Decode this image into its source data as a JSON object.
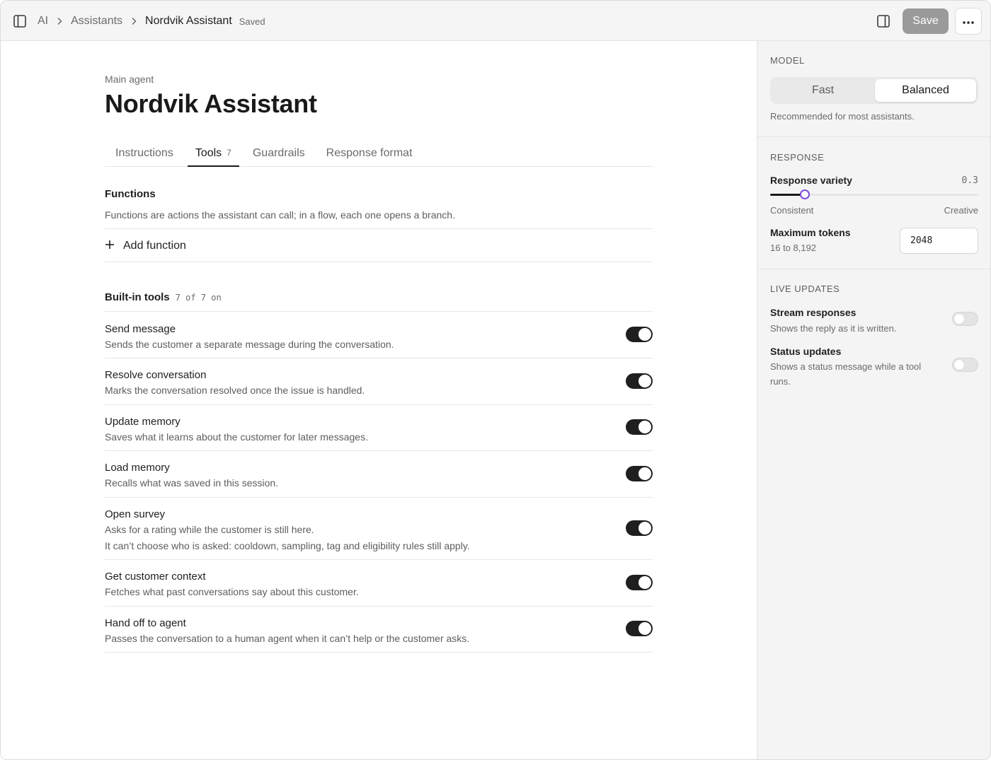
{
  "topbar": {
    "breadcrumbs": [
      "AI",
      "Assistants",
      "Nordvik Assistant"
    ],
    "saved_status": "Saved",
    "save_label": "Save",
    "icons": {
      "sidebar_toggle": "sidebar-toggle-icon",
      "panel_toggle": "panel-toggle-icon",
      "more": "more-horizontal-icon",
      "separator": "chevron-right-icon"
    }
  },
  "page": {
    "eyebrow": "Main agent",
    "title": "Nordvik Assistant",
    "tabs": [
      {
        "label": "Instructions"
      },
      {
        "label": "Tools",
        "count": "7",
        "active": true
      },
      {
        "label": "Guardrails"
      },
      {
        "label": "Response format"
      }
    ]
  },
  "functions": {
    "heading": "Functions",
    "description": "Functions are actions the assistant can call; in a flow, each one opens a branch.",
    "add_label": "Add function"
  },
  "builtin": {
    "heading": "Built-in tools",
    "count_text": "7 of 7 on",
    "tools": [
      {
        "name": "Send message",
        "description": "Sends the customer a separate message during the conversation.",
        "enabled": true
      },
      {
        "name": "Resolve conversation",
        "description": "Marks the conversation resolved once the issue is handled.",
        "enabled": true
      },
      {
        "name": "Update memory",
        "description": "Saves what it learns about the customer for later messages.",
        "enabled": true
      },
      {
        "name": "Load memory",
        "description": "Recalls what was saved in this session.",
        "enabled": true
      },
      {
        "name": "Open survey",
        "description": "Asks for a rating while the customer is still here.",
        "note": "It can’t choose who is asked: cooldown, sampling, tag and eligibility rules still apply.",
        "enabled": true
      },
      {
        "name": "Get customer context",
        "description": "Fetches what past conversations say about this customer.",
        "enabled": true
      },
      {
        "name": "Hand off to agent",
        "description": "Passes the conversation to a human agent when it can’t help or the customer asks.",
        "enabled": true
      }
    ]
  },
  "sidebar": {
    "model": {
      "label": "MODEL",
      "options": [
        "Fast",
        "Balanced"
      ],
      "selected": "Balanced",
      "hint": "Recommended for most assistants."
    },
    "response": {
      "label": "RESPONSE",
      "variety_label": "Response variety",
      "variety_value": "0.3",
      "variety_level": 0.3,
      "scale_min": "Consistent",
      "scale_max": "Creative",
      "tokens_label": "Maximum tokens",
      "tokens_range": "16 to 8,192",
      "tokens_value": "2048"
    },
    "live_updates": {
      "label": "LIVE UPDATES",
      "items": [
        {
          "name": "Stream responses",
          "description": "Shows the reply as it is written.",
          "enabled": false
        },
        {
          "name": "Status updates",
          "description": "Shows a status message while a tool runs.",
          "enabled": false
        }
      ]
    }
  },
  "colors": {
    "accent": "#7c4ddb",
    "toggle_on": "#1f1f1f",
    "save_disabled": "#9a9a9a"
  }
}
